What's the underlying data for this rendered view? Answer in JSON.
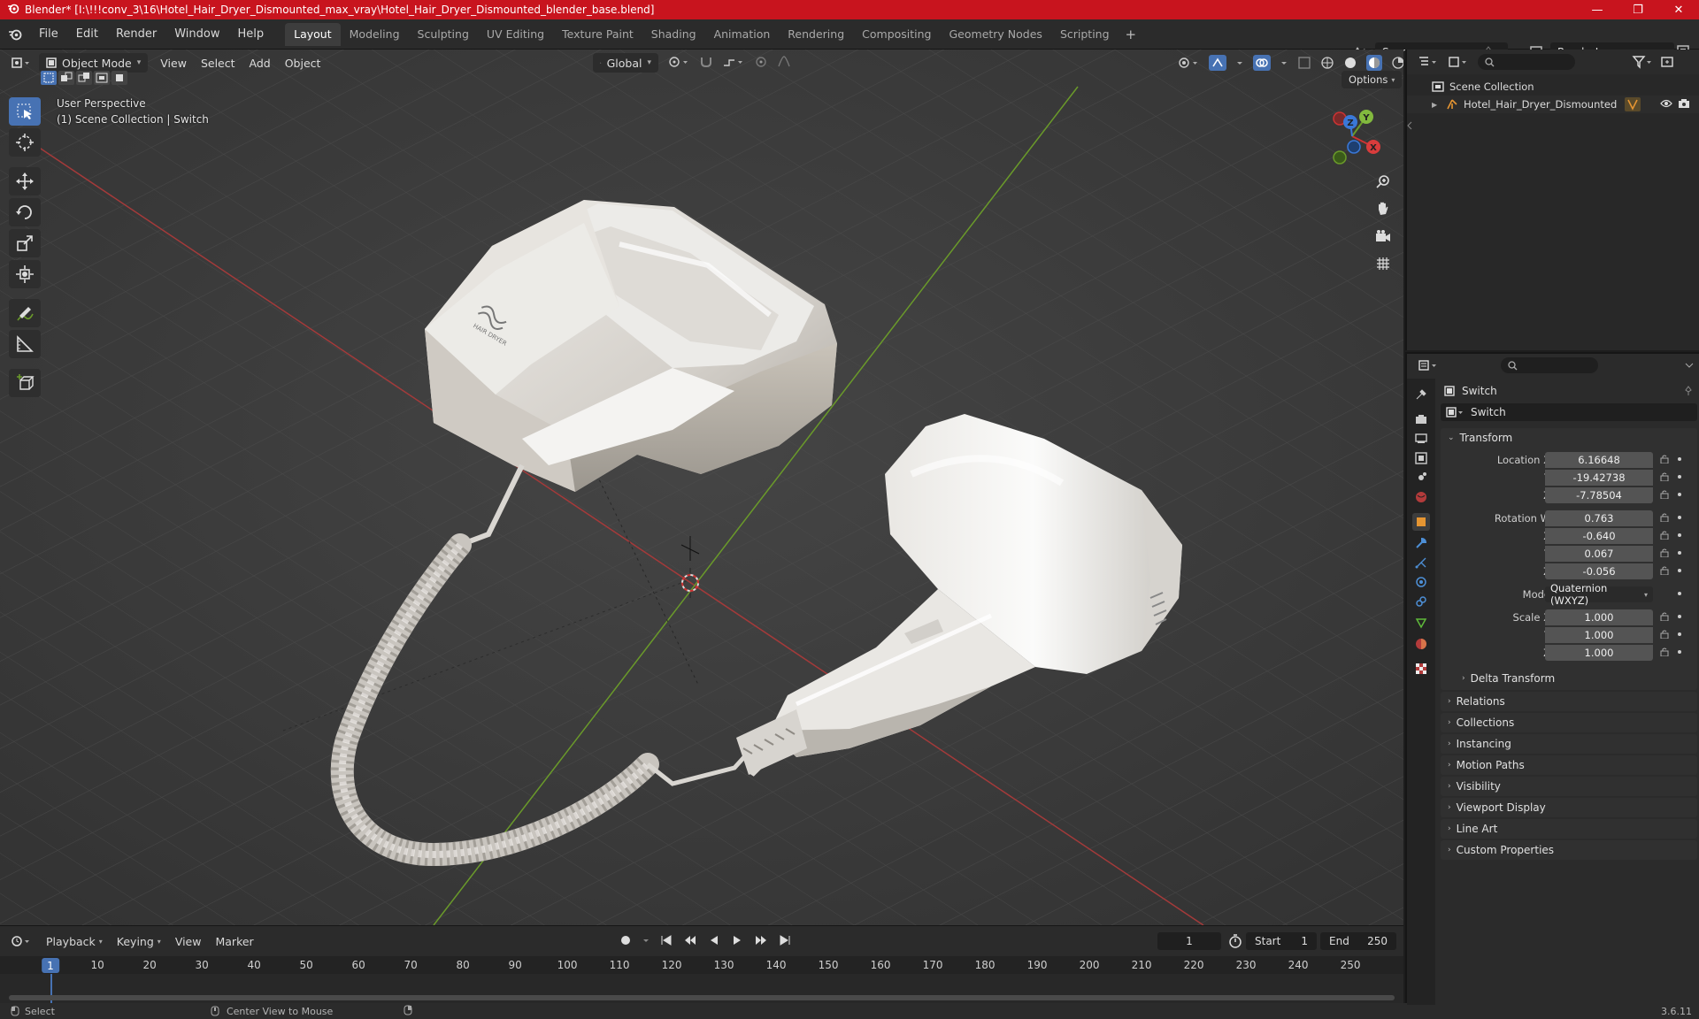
{
  "window": {
    "title": "Blender* [I:\\!!!conv_3\\16\\Hotel_Hair_Dryer_Dismounted_max_vray\\Hotel_Hair_Dryer_Dismounted_blender_base.blend]",
    "minimize": "—",
    "restore": "❐",
    "close": "✕"
  },
  "menu": {
    "items": [
      "File",
      "Edit",
      "Render",
      "Window",
      "Help"
    ],
    "workspaces": [
      "Layout",
      "Modeling",
      "Sculpting",
      "UV Editing",
      "Texture Paint",
      "Shading",
      "Animation",
      "Rendering",
      "Compositing",
      "Geometry Nodes",
      "Scripting"
    ],
    "active_workspace": "Layout",
    "add_tab": "+",
    "scene": "Scene",
    "view_layer": "RenderLayer"
  },
  "viewport": {
    "mode": "Object Mode",
    "menus": [
      "View",
      "Select",
      "Add",
      "Object"
    ],
    "orientation": "Global",
    "options": "Options",
    "perspective": "User Perspective",
    "collection_path": "(1) Scene Collection | Switch",
    "product_label": "HAIR DRYER",
    "gizmo": {
      "x": "X",
      "y": "Y",
      "z": "Z"
    }
  },
  "outliner": {
    "search_placeholder": "",
    "root": "Scene Collection",
    "object": "Hotel_Hair_Dryer_Dismounted"
  },
  "properties": {
    "search_placeholder": "",
    "object_name": "Switch",
    "object_field": "Switch",
    "transform": {
      "header": "Transform",
      "location_label": "Location X",
      "location": [
        "6.16648",
        "-19.42738",
        "-7.78504"
      ],
      "rotation_label": "Rotation W",
      "rotation": [
        "0.763",
        "-0.640",
        "0.067",
        "-0.056"
      ],
      "axis_labels": [
        "X",
        "Y",
        "Z"
      ],
      "mode_label": "Mode",
      "mode_value": "Quaternion (WXYZ)",
      "scale_label": "Scale X",
      "scale": [
        "1.000",
        "1.000",
        "1.000"
      ],
      "delta": "Delta Transform"
    },
    "panels": [
      "Relations",
      "Collections",
      "Instancing",
      "Motion Paths",
      "Visibility",
      "Viewport Display",
      "Line Art",
      "Custom Properties"
    ]
  },
  "timeline": {
    "menus": [
      "Playback",
      "Keying",
      "View",
      "Marker"
    ],
    "current_frame": "1",
    "start_label": "Start",
    "start": "1",
    "end_label": "End",
    "end": "250",
    "ticks": [
      "10",
      "20",
      "30",
      "40",
      "50",
      "60",
      "70",
      "80",
      "90",
      "100",
      "110",
      "120",
      "130",
      "140",
      "150",
      "160",
      "170",
      "180",
      "190",
      "200",
      "210",
      "220",
      "230",
      "240",
      "250"
    ]
  },
  "status": {
    "select": "Select",
    "center": "Center View to Mouse",
    "version": "3.6.11"
  },
  "colors": {
    "title_bar": "#c8141e",
    "accent": "#4772b3",
    "x_axis": "#b33b3b",
    "y_axis": "#6a9a2a",
    "z_axis": "#3a78d8"
  }
}
